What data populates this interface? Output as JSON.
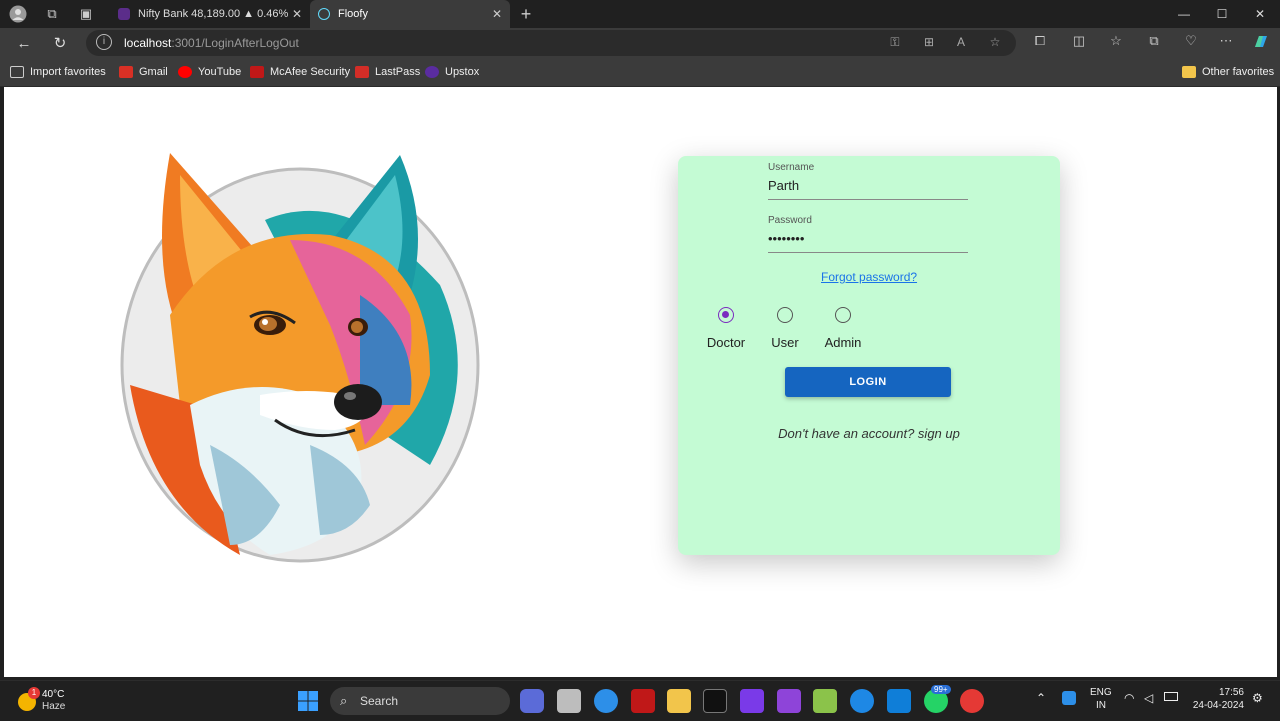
{
  "browser": {
    "tabs": [
      {
        "title": "Nifty Bank 48,189.00 ▲ 0.46%",
        "active": false,
        "favicon_color": "#5b2d8a"
      },
      {
        "title": "Floofy",
        "active": true,
        "favicon_color": "#61dafb"
      }
    ],
    "new_tab_symbol": "+",
    "address": {
      "host": "localhost",
      "path": ":3001/LoginAfterLogOut"
    },
    "favorites": [
      {
        "label": "Import favorites",
        "color": "#cccccc"
      },
      {
        "label": "Gmail",
        "color": "#d93025"
      },
      {
        "label": "YouTube",
        "color": "#ff0000"
      },
      {
        "label": "McAfee Security",
        "color": "#c01818"
      },
      {
        "label": "LastPass",
        "color": "#d32d27"
      },
      {
        "label": "Upstox",
        "color": "#5a2ca0"
      }
    ],
    "other_favorites": "Other favorites"
  },
  "login": {
    "username_label": "Username",
    "username_value": "Parth",
    "password_label": "Password",
    "password_value": "••••••••",
    "forgot": "Forgot password?",
    "roles": [
      {
        "label": "Doctor",
        "checked": true
      },
      {
        "label": "User",
        "checked": false
      },
      {
        "label": "Admin",
        "checked": false
      }
    ],
    "login_button": "LOGIN",
    "signup_text": "Don't have an account? sign up",
    "card_color": "#c4fbd4",
    "button_color": "#1565c0"
  },
  "taskbar": {
    "weather_temp": "40°C",
    "weather_desc": "Haze",
    "weather_badge": "1",
    "search_label": "Search",
    "whatsapp_badge": "99+",
    "lang1": "ENG",
    "lang2": "IN",
    "time": "17:56",
    "date": "24-04-2024"
  }
}
